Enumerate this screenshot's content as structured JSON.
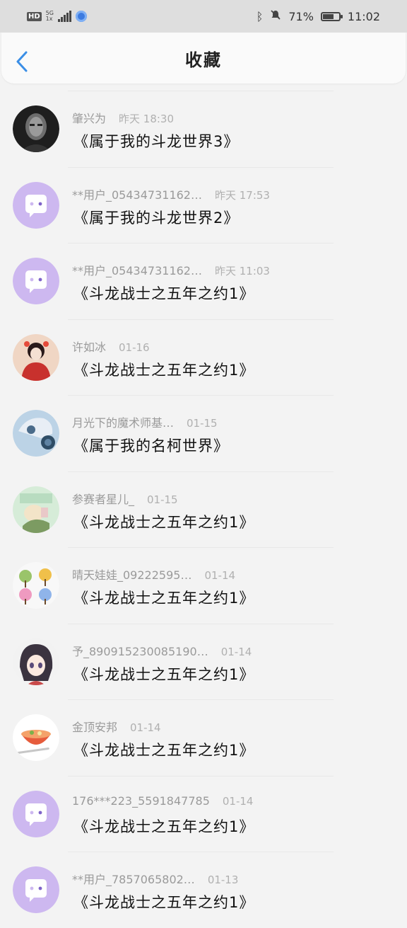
{
  "status_bar": {
    "hd": "HD",
    "network": "5G",
    "network_sub": "1x",
    "battery_percent": "71%",
    "battery_level": 0.71,
    "time": "11:02"
  },
  "header": {
    "title": "收藏"
  },
  "items": [
    {
      "author": "肇兴为",
      "time": "昨天 18:30",
      "title": "《属于我的斗龙世界3》",
      "avatar": "photo-dark"
    },
    {
      "author": "**用户_05434731162…",
      "time": "昨天 17:53",
      "title": "《属于我的斗龙世界2》",
      "avatar": "default-chat"
    },
    {
      "author": "**用户_05434731162…",
      "time": "昨天 11:03",
      "title": "《斗龙战士之五年之约1》",
      "avatar": "default-chat"
    },
    {
      "author": "许如冰",
      "time": "01-16",
      "title": "《斗龙战士之五年之约1》",
      "avatar": "photo-red"
    },
    {
      "author": "月光下的魔术师基…",
      "time": "01-15",
      "title": "《属于我的名柯世界》",
      "avatar": "photo-blue"
    },
    {
      "author": "参赛者星儿_",
      "time": "01-15",
      "title": "《斗龙战士之五年之约1》",
      "avatar": "photo-green"
    },
    {
      "author": "晴天娃娃_09222595…",
      "time": "01-14",
      "title": "《斗龙战士之五年之约1》",
      "avatar": "photo-trees"
    },
    {
      "author": "予_890915230085190…",
      "time": "01-14",
      "title": "《斗龙战士之五年之约1》",
      "avatar": "photo-anime"
    },
    {
      "author": "金顶安邦",
      "time": "01-14",
      "title": "《斗龙战士之五年之约1》",
      "avatar": "photo-bowl"
    },
    {
      "author": "176***223_5591847785",
      "time": "01-14",
      "title": "《斗龙战士之五年之约1》",
      "avatar": "default-chat"
    },
    {
      "author": "**用户_7857065802…",
      "time": "01-13",
      "title": "《斗龙战士之五年之约1》",
      "avatar": "default-chat"
    }
  ]
}
